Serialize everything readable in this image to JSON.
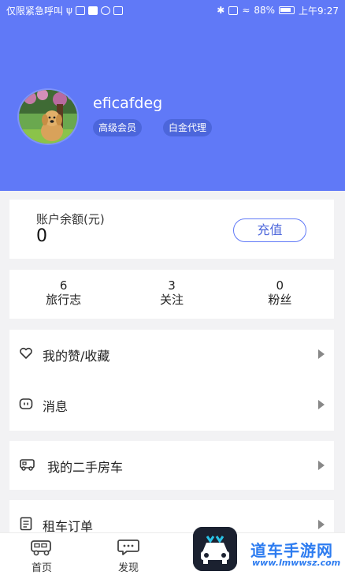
{
  "status_bar": {
    "left_text": "仅限紧急呼叫",
    "battery": "88%",
    "time": "上午9:27"
  },
  "profile": {
    "username": "eficafdeg",
    "badges": [
      "高级会员",
      "白金代理"
    ]
  },
  "balance": {
    "label": "账户余额(元)",
    "value": "0",
    "recharge_label": "充值"
  },
  "stats": [
    {
      "value": "6",
      "label": "旅行志"
    },
    {
      "value": "3",
      "label": "关注"
    },
    {
      "value": "0",
      "label": "粉丝"
    }
  ],
  "menu": {
    "likes": "我的赞/收藏",
    "messages": "消息",
    "used_rv": "我的二手房车",
    "rental_orders": "租车订单"
  },
  "tabbar": {
    "home": "首页",
    "discover": "发现"
  },
  "watermark": {
    "title": "道车手游网",
    "url": "www.lmwwsz.com"
  },
  "colors": {
    "header": "#6079f7",
    "badge": "#4c66db",
    "accent": "#4c66db"
  }
}
